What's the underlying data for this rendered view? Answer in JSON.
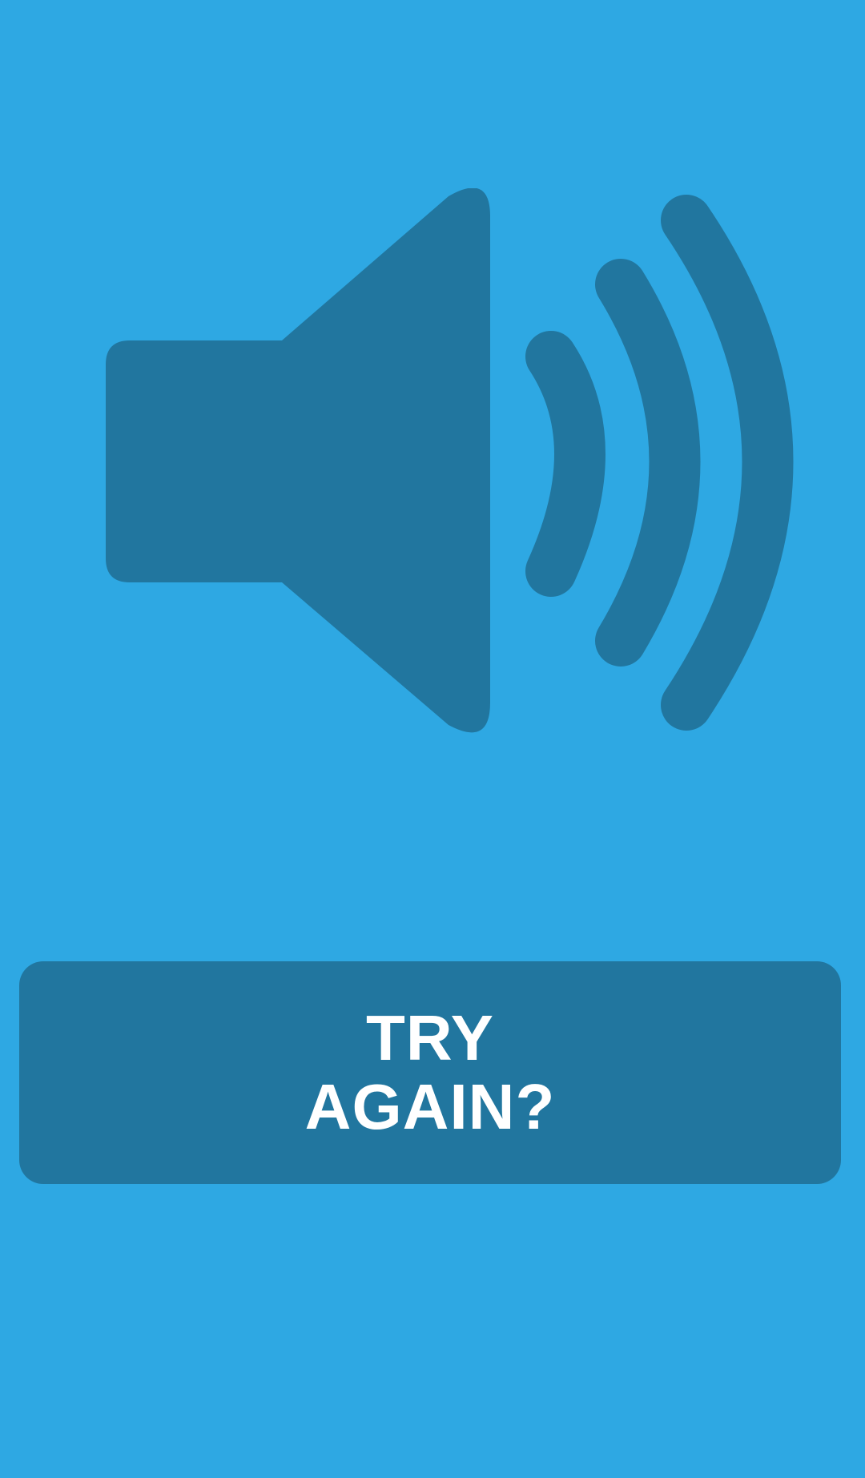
{
  "screen": {
    "background_color": "#2EA8E3"
  },
  "speaker": {
    "icon": "volume-up-icon",
    "color": "#21769F"
  },
  "retry_button": {
    "label": "TRY\nAGAIN?",
    "background_color": "#21769F",
    "text_color": "#FFFFFF"
  }
}
